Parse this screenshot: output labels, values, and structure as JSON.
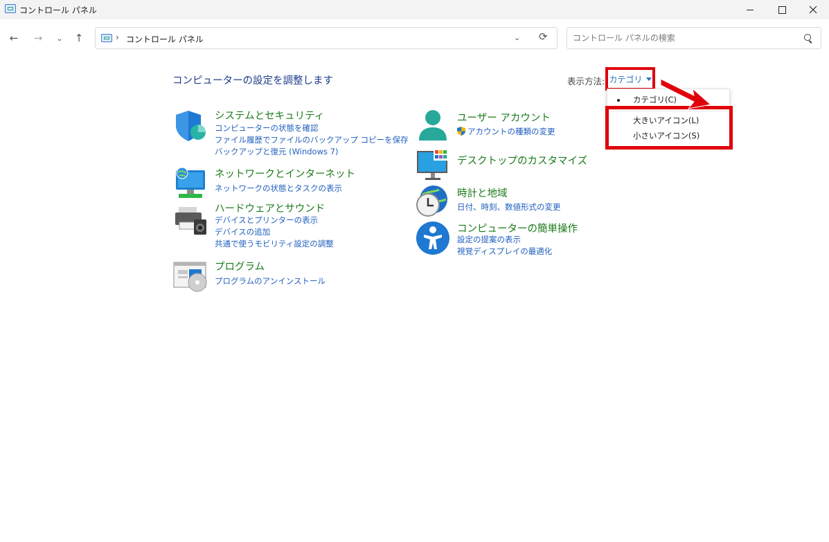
{
  "window": {
    "title": "コントロール パネル"
  },
  "nav": {
    "back": "←",
    "forward": "→",
    "recent": "⌄",
    "up": "↑"
  },
  "address": {
    "separator": "›",
    "path": "コントロール パネル",
    "chevron": "⌄",
    "refresh": "⟳"
  },
  "search": {
    "placeholder": "コントロール パネルの検索"
  },
  "main": {
    "heading": "コンピューターの設定を調整します",
    "view_by_label": "表示方法:",
    "view_by_value": "カテゴリ",
    "dropdown": [
      {
        "label": "カテゴリ(C)",
        "selected": true
      },
      {
        "label": "大きいアイコン(L)",
        "selected": false
      },
      {
        "label": "小さいアイコン(S)",
        "selected": false
      }
    ]
  },
  "categories": [
    {
      "title": "システムとセキュリティ",
      "icon": "shield-icon",
      "links": [
        "コンピューターの状態を確認",
        "ファイル履歴でファイルのバックアップ コピーを保存",
        "バックアップと復元 (Windows 7)"
      ]
    },
    {
      "title": "ネットワークとインターネット",
      "icon": "network-globe-icon",
      "links": [
        "ネットワークの状態とタスクの表示"
      ]
    },
    {
      "title": "ハードウェアとサウンド",
      "icon": "printer-speaker-icon",
      "links": [
        "デバイスとプリンターの表示",
        "デバイスの追加",
        "共通で使うモビリティ設定の調整"
      ]
    },
    {
      "title": "プログラム",
      "icon": "programs-disc-icon",
      "links": [
        "プログラムのアンインストール"
      ]
    },
    {
      "title": "ユーザー アカウント",
      "icon": "user-icon",
      "links": [
        "アカウントの種類の変更"
      ]
    },
    {
      "title": "デスクトップのカスタマイズ",
      "icon": "desktop-monitor-icon",
      "links": []
    },
    {
      "title": "時計と地域",
      "icon": "clock-globe-icon",
      "links": [
        "日付、時刻、数値形式の変更"
      ]
    },
    {
      "title": "コンピューターの簡単操作",
      "icon": "accessibility-icon",
      "links": [
        "設定の提案の表示",
        "視覚ディスプレイの最適化"
      ]
    }
  ],
  "colors": {
    "highlight": "#e0000a",
    "link": "#1f5fbf",
    "category_title": "#1a7a1a",
    "heading": "#1e3c8c"
  }
}
